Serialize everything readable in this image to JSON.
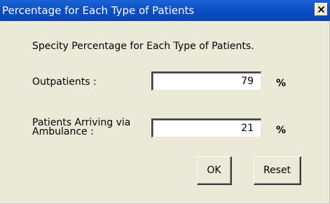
{
  "window": {
    "title": "Percentage for Each Type of Patients",
    "close_icon": "close-icon"
  },
  "instruction": "Specity Percentage for Each Type of Patients.",
  "fields": [
    {
      "label": "Outpatients :",
      "value": "79",
      "unit": "%"
    },
    {
      "label_line1": "Patients Arriving via",
      "label_line2": "Ambulance :",
      "value": "21",
      "unit": "%"
    }
  ],
  "buttons": {
    "ok_label": "OK",
    "reset_label": "Reset"
  }
}
